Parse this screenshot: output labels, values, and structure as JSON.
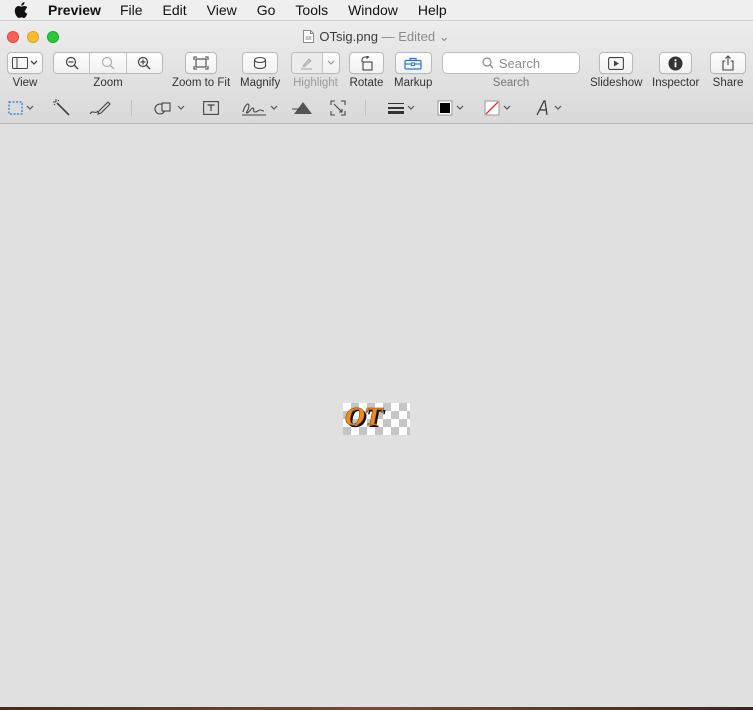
{
  "menubar": {
    "app_name": "Preview",
    "items": [
      "File",
      "Edit",
      "View",
      "Go",
      "Tools",
      "Window",
      "Help"
    ]
  },
  "window": {
    "filename": "OTsig.png",
    "status": "— Edited",
    "title_chevron": "⌄"
  },
  "toolbar": {
    "view_label": "View",
    "zoom_label": "Zoom",
    "zoom_to_fit_label": "Zoom to Fit",
    "magnify_label": "Magnify",
    "highlight_label": "Highlight",
    "rotate_label": "Rotate",
    "markup_label": "Markup",
    "search_placeholder": "Search",
    "search_label": "Search",
    "slideshow_label": "Slideshow",
    "inspector_label": "Inspector",
    "share_label": "Share"
  },
  "document": {
    "image_text": "OT"
  },
  "colors": {
    "signature_orange": "#f08a1c",
    "signature_shadow": "#222222",
    "close": "#fc5f57",
    "minimize": "#fdbc2e",
    "maximize": "#28c840"
  }
}
